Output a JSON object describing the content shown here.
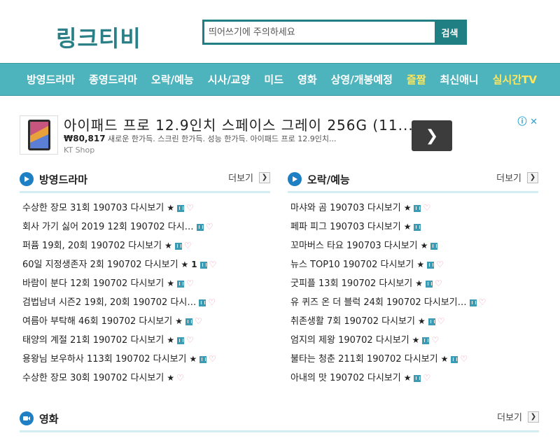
{
  "header": {
    "logo": "링크티비",
    "search_placeholder": "띄어쓰기에 주의하세요",
    "search_button": "검색"
  },
  "nav": [
    {
      "label": "방영드라마",
      "highlight": false
    },
    {
      "label": "종영드라마",
      "highlight": false
    },
    {
      "label": "오락/예능",
      "highlight": false
    },
    {
      "label": "시사/교양",
      "highlight": false
    },
    {
      "label": "미드",
      "highlight": false
    },
    {
      "label": "영화",
      "highlight": false
    },
    {
      "label": "상영/개봉예정",
      "highlight": false
    },
    {
      "label": "즐짤",
      "highlight": true
    },
    {
      "label": "최신애니",
      "highlight": false
    },
    {
      "label": "실시간TV",
      "highlight": true
    }
  ],
  "ad": {
    "title": "아이패드 프로 12.9인치 스페이스 그레이 256G (11...",
    "price": "₩80,817",
    "desc": "새로운 한가득. 스크린 한가득. 성능 한가득. 아이패드 프로 12.9인치...",
    "source": "KT Shop"
  },
  "sections": {
    "drama": {
      "title": "방영드라마",
      "more": "더보기",
      "items": [
        {
          "text": "수상한 장모 31회 190703 다시보기",
          "star": true,
          "n": true,
          "heart": true
        },
        {
          "text": "회사 가기 싫어 2019 12회 190702 다시…",
          "star": false,
          "n": true,
          "heart": true
        },
        {
          "text": "퍼퓸 19회, 20회 190702 다시보기",
          "star": true,
          "n": true,
          "heart": true
        },
        {
          "text": "60일 지정생존자 2회 190702 다시보기",
          "star": true,
          "num": "1",
          "n": true,
          "heart": true
        },
        {
          "text": "바람이 분다 12회 190702 다시보기",
          "star": true,
          "n": true,
          "heart": true
        },
        {
          "text": "검법남녀 시즌2 19회, 20회 190702 다시…",
          "star": false,
          "n": true,
          "heart": true
        },
        {
          "text": "여름아 부탁해 46회 190702 다시보기",
          "star": true,
          "n": true,
          "heart": true
        },
        {
          "text": "태양의 계절 21회 190702 다시보기",
          "star": true,
          "n": true,
          "heart": true
        },
        {
          "text": "용왕님 보우하사 113회 190702 다시보기",
          "star": true,
          "n": true,
          "heart": true
        },
        {
          "text": "수상한 장모 30회 190702 다시보기",
          "star": true,
          "n": false,
          "heart": true
        }
      ]
    },
    "variety": {
      "title": "오락/예능",
      "more": "더보기",
      "items": [
        {
          "text": "마샤와 곰 190703 다시보기",
          "star": true,
          "n": true,
          "heart": true
        },
        {
          "text": "페파 피그 190703 다시보기",
          "star": true,
          "n": true,
          "heart": false
        },
        {
          "text": "꼬마버스 타요 190703 다시보기",
          "star": true,
          "n": true,
          "heart": false
        },
        {
          "text": "뉴스 TOP10 190702 다시보기",
          "star": true,
          "n": true,
          "heart": true
        },
        {
          "text": "굿피플 13회 190702 다시보기",
          "star": true,
          "n": true,
          "heart": true
        },
        {
          "text": "유 퀴즈 온 더 블럭 24회 190702 다시보기…",
          "star": false,
          "n": true,
          "heart": true
        },
        {
          "text": "취존생활 7회 190702 다시보기",
          "star": true,
          "n": true,
          "heart": true
        },
        {
          "text": "엄지의 제왕 190702 다시보기",
          "star": true,
          "n": true,
          "heart": true
        },
        {
          "text": "불타는 청춘 211회 190702 다시보기",
          "star": true,
          "n": true,
          "heart": true
        },
        {
          "text": "아내의 맛 190702 다시보기",
          "star": true,
          "n": true,
          "heart": true
        }
      ]
    },
    "movie": {
      "title": "영화",
      "more": "더보기"
    }
  },
  "colors": {
    "brand": "#2b7f86",
    "nav_bg": "#4db3bc",
    "highlight": "#ffe65a"
  }
}
